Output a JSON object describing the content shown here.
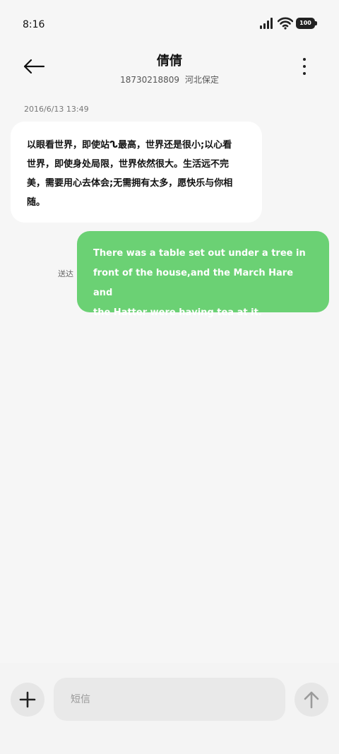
{
  "status_bar": {
    "time": "8:16",
    "battery_level": "100",
    "icons": [
      "signal-icon",
      "wifi-icon",
      "battery-icon"
    ]
  },
  "header": {
    "contact_name": "倩倩",
    "phone_number": "18730218809",
    "location": "河北保定",
    "icons": [
      "back-arrow-icon",
      "more-vertical-icon"
    ]
  },
  "conversation": {
    "timestamp": "2016/6/13 13:49",
    "messages": [
      {
        "direction": "incoming",
        "lines": [
          "以眼看世界，即使站ᔐ最高，世界还是很小;以心看",
          "世界，即使身处局限，世界依然很大。生活远不完",
          "美，需要用心去体会;无需拥有太多，愿快乐与你相",
          "随。"
        ]
      },
      {
        "direction": "outgoing",
        "status": "送达",
        "lines": [
          "There was a table set out under a tree in",
          "front of the house,and the March Hare and",
          "the Hatter were having tea at it."
        ]
      }
    ]
  },
  "composer": {
    "placeholder": "短信",
    "value": "",
    "icons": [
      "plus-icon",
      "send-arrow-icon"
    ]
  },
  "colors": {
    "background": "#f6f6f6",
    "incoming_bubble": "#ffffff",
    "outgoing_bubble": "#6bd174",
    "button_bg": "#e6e6e6"
  }
}
